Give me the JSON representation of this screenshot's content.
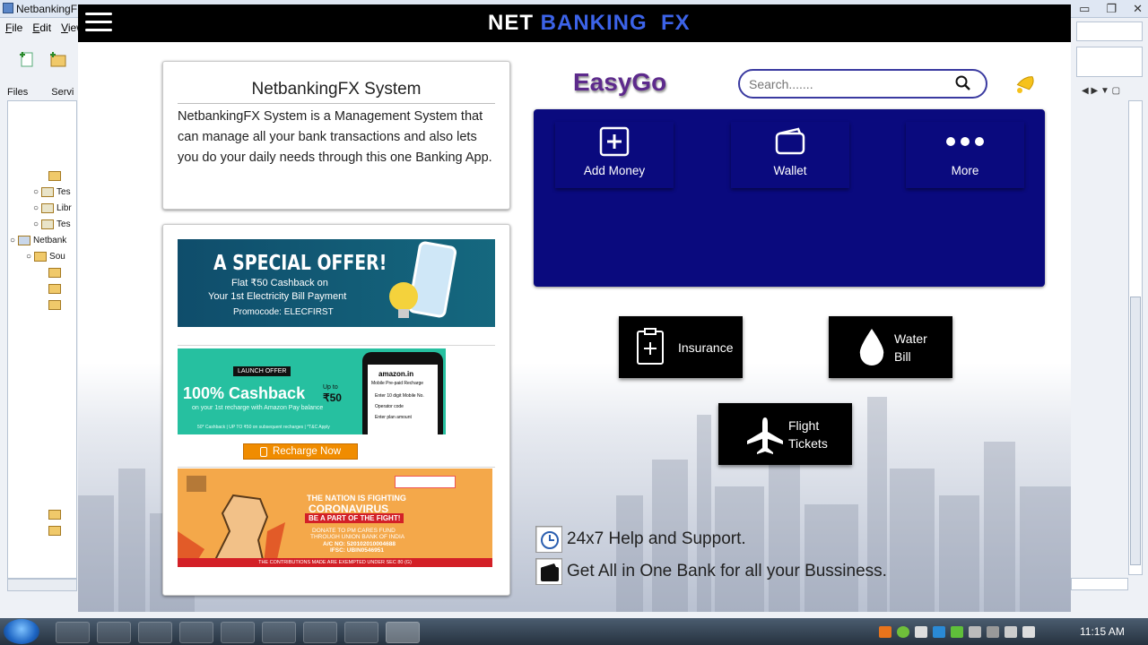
{
  "ide": {
    "title": "NetbankingF",
    "menu": [
      "File",
      "Edit",
      "View"
    ],
    "tabs": [
      "Files",
      "Servi"
    ],
    "tree": [
      "Tes",
      "Libr",
      "Tes",
      "Netbank",
      "Sou"
    ]
  },
  "app": {
    "brand_a": "NET",
    "brand_b": "BANKING  FX",
    "system_title": "NetbankingFX System",
    "system_desc": "NetbankingFX System is a Management System that can manage all your bank transactions and also lets you do your daily needs through this one Banking App.",
    "banner1": {
      "title": "A SPECIAL OFFER!",
      "line1": "Flat ₹50 Cashback on",
      "line2": "Your 1st Electricity Bill Payment",
      "code": "Promocode: ELECFIRST"
    },
    "banner2": {
      "tag": "LAUNCH OFFER",
      "big": "100% Cashback",
      "upto": "Up to",
      "amt": "₹50",
      "sub": "on your 1st recharge with Amazon Pay balance",
      "fine": "50* Cashback | UP TO ₹50 on subsequent recharges | *T&C Apply",
      "phone_brand": "amazon.in",
      "phone_l1": "Mobile Pre-paid Recharge",
      "phone_l2": "Enter 10 digit Mobile No.",
      "phone_l3": "Operator code",
      "phone_l4": "Enter plan amount"
    },
    "recharge_label": "Recharge Now",
    "banner3": {
      "l1": "THE NATION IS FIGHTING",
      "l2": "CORONAVIRUS",
      "l3": "BE A PART OF THE FIGHT!",
      "l4": "DONATE TO PM CARES FUND",
      "l5": "THROUGH UNION BANK OF INDIA",
      "l6": "A/C NO: 520102010004688",
      "l7": "IFSC: UBIN0546951",
      "l8": "THE CONTRIBUTIONS MADE ARE EXEMPTED UNDER SEC 80 (G)"
    },
    "easygo": "EasyGo",
    "search_placeholder": "Search.......",
    "actions": [
      "Add Money",
      "Wallet",
      "More"
    ],
    "services": {
      "insurance": "Insurance",
      "water_1": "Water",
      "water_2": "Bill",
      "flight_1": "Flight",
      "flight_2": "Tickets"
    },
    "features": [
      "24x7 Help and Support.",
      "Get All in One Bank for all your Bussiness."
    ]
  },
  "taskbar": {
    "clock": "11:15 AM"
  },
  "colors": {
    "topbar": "#000000",
    "brand_blue": "#3c63e8",
    "panel_blue": "#0a0a7e",
    "easygo": "#5d2a8c",
    "search_border": "#3a3aa0"
  },
  "icons": [
    "hamburger-menu-icon",
    "search-icon",
    "bell-icon",
    "add-box-icon",
    "wallet-icon",
    "more-dots-icon",
    "clipboard-plus-icon",
    "water-drop-icon",
    "airplane-icon",
    "help-24x7-icon",
    "wallet-bag-icon"
  ]
}
